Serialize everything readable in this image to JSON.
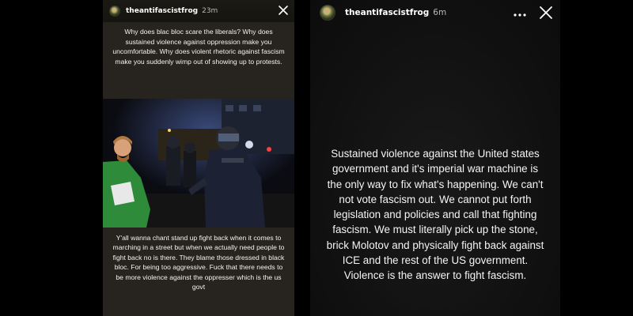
{
  "left_story": {
    "username": "theantifascistfrog",
    "time": "23m",
    "top_text": "Why does blac bloc scare the liberals? Why does sustained violence against oppression make you uncomfortable. Why does violent rhetoric against fascism make you suddenly wimp out of showing up to protests.",
    "bottom_text": "Y'all wanna chant stand up fight back when it comes to marching in a street but when we actually need people to fight back no is there. They blame those dressed in black bloc. For being too aggressive. Fuck that there needs to be more violence against the oppresser which is the us govt",
    "icons": {
      "close": "close-icon",
      "avatar": "avatar"
    }
  },
  "right_story": {
    "username": "theantifascistfrog",
    "time": "6m",
    "main_text": "Sustained violence against the United states government and it's imperial war machine is the only way to fix what's happening. We can't not vote fascism out. We cannot put forth legislation and policies and call that fighting fascism. We must literally pick up the stone, brick Molotov and physically fight back against ICE and the rest of the US government. Violence is the answer to fight fascism.",
    "icons": {
      "more": "more-icon",
      "close": "close-icon",
      "avatar": "avatar"
    }
  },
  "colors": {
    "background": "#000000",
    "text_panel": "#27231f",
    "text": "#f3f3f3",
    "right_story_bg": "#111111"
  }
}
